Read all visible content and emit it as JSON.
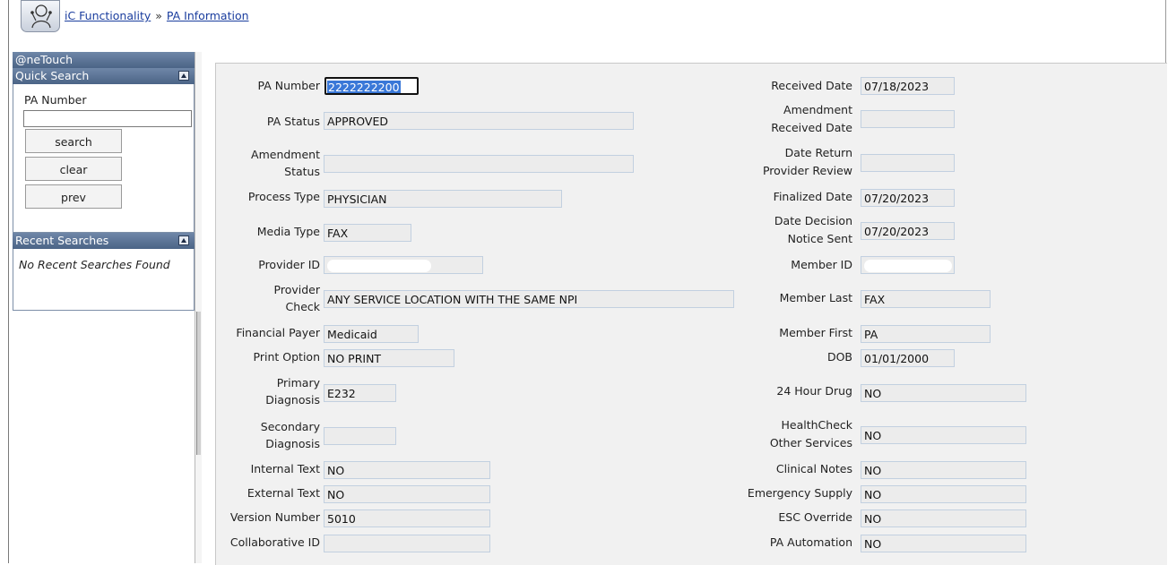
{
  "breadcrumb": {
    "first": "iC Functionality",
    "separator": "»",
    "second": "PA Information"
  },
  "sidebar": {
    "title": "@neTouch",
    "quick_search": {
      "heading": "Quick Search",
      "pa_number_label": "PA Number",
      "pa_number_value": "",
      "search_label": "search",
      "clear_label": "clear",
      "prev_label": "prev"
    },
    "recent_searches": {
      "heading": "Recent Searches",
      "empty_text": "No Recent Searches Found"
    }
  },
  "form": {
    "left": {
      "pa_number": {
        "label": "PA Number",
        "value": "2222222200"
      },
      "pa_status": {
        "label": "PA Status",
        "value": "APPROVED"
      },
      "amendment_status": {
        "label_1": "Amendment",
        "label_2": "Status",
        "value": ""
      },
      "process_type": {
        "label": "Process Type",
        "value": "PHYSICIAN"
      },
      "media_type": {
        "label": "Media Type",
        "value": "FAX"
      },
      "provider_id": {
        "label": "Provider ID",
        "value": ""
      },
      "provider_check": {
        "label_1": "Provider",
        "label_2": "Check",
        "value": "ANY SERVICE LOCATION WITH THE SAME NPI"
      },
      "financial_payer": {
        "label": "Financial Payer",
        "value": "Medicaid"
      },
      "print_option": {
        "label": "Print Option",
        "value": "NO PRINT"
      },
      "primary_diagnosis": {
        "label_1": "Primary",
        "label_2": "Diagnosis",
        "value": "E232"
      },
      "secondary_diagnosis": {
        "label_1": "Secondary",
        "label_2": "Diagnosis",
        "value": ""
      },
      "internal_text": {
        "label": "Internal Text",
        "value": "NO"
      },
      "external_text": {
        "label": "External Text",
        "value": "NO"
      },
      "version_number": {
        "label": "Version Number",
        "value": "5010"
      },
      "collaborative_id": {
        "label": "Collaborative ID",
        "value": ""
      }
    },
    "right": {
      "received_date": {
        "label": "Received Date",
        "value": "07/18/2023"
      },
      "amendment_received_date": {
        "label_1": "Amendment",
        "label_2": "Received Date",
        "value": ""
      },
      "date_return_provider_review": {
        "label_1": "Date Return",
        "label_2": "Provider Review",
        "value": ""
      },
      "finalized_date": {
        "label": "Finalized Date",
        "value": "07/20/2023"
      },
      "date_decision_notice_sent": {
        "label_1": "Date Decision",
        "label_2": "Notice Sent",
        "value": "07/20/2023"
      },
      "member_id": {
        "label": "Member ID",
        "value": ""
      },
      "member_last": {
        "label": "Member Last",
        "value": "FAX"
      },
      "member_first": {
        "label": "Member First",
        "value": "PA"
      },
      "dob": {
        "label": "DOB",
        "value": "01/01/2000"
      },
      "hour_24_drug": {
        "label": "24 Hour Drug",
        "value": "NO"
      },
      "healthcheck_other_services": {
        "label_1": "HealthCheck",
        "label_2": "Other Services",
        "value": "NO"
      },
      "clinical_notes": {
        "label": "Clinical Notes",
        "value": "NO"
      },
      "emergency_supply": {
        "label": "Emergency Supply",
        "value": "NO"
      },
      "esc_override": {
        "label": "ESC Override",
        "value": "NO"
      },
      "pa_automation": {
        "label": "PA Automation",
        "value": "NO"
      }
    }
  }
}
